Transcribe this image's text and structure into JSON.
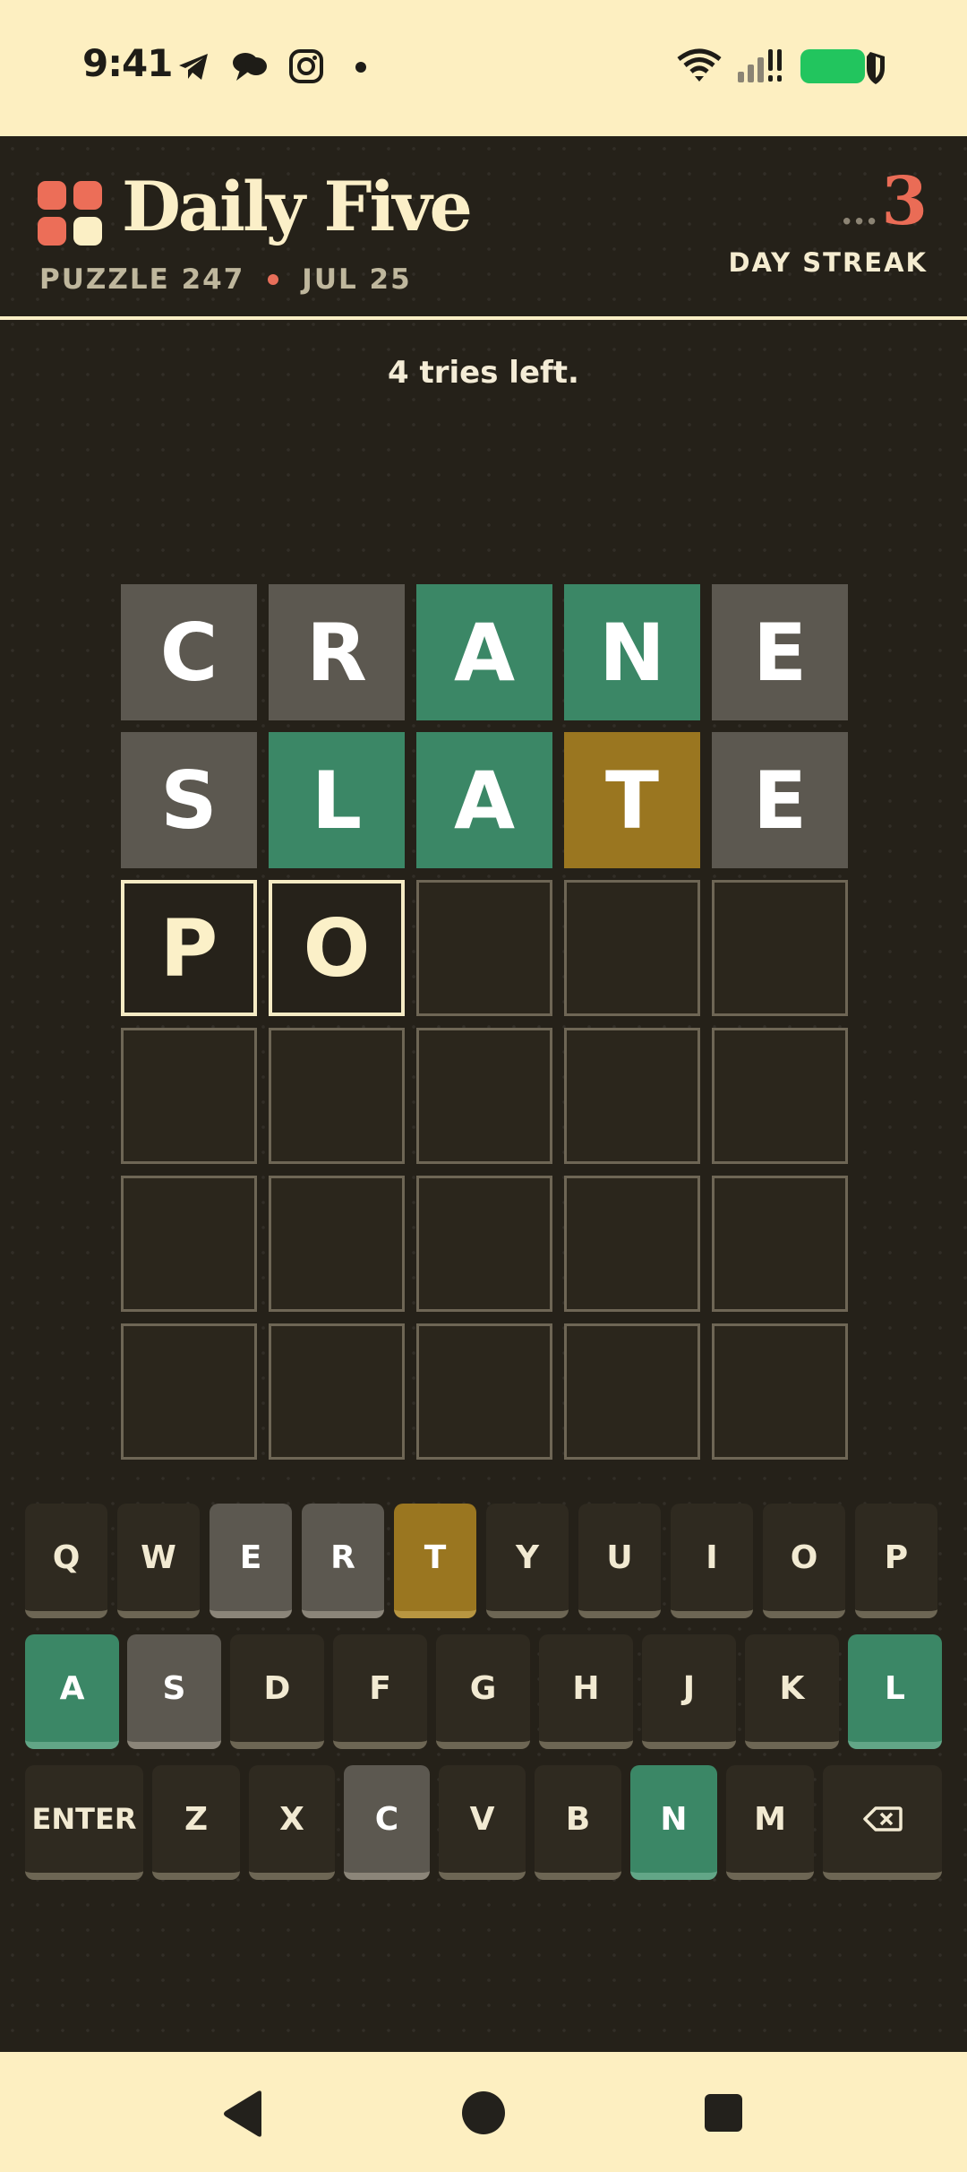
{
  "status_bar": {
    "time": "9:41",
    "left_icons": [
      "telegram-icon",
      "chat-bubble-icon",
      "instagram-icon",
      "dot-icon"
    ],
    "right_icons": [
      "wifi-icon",
      "signal-icon",
      "battery-icon",
      "shield-icon"
    ],
    "battery_color": "#22c55e"
  },
  "header": {
    "title": "Daily Five",
    "puzzle": "PUZZLE 247",
    "date": "JUL 25",
    "streak_prefix": "...",
    "streak_count": "3",
    "streak_label": "DAY STREAK",
    "logo_colors": [
      "#ec6e58",
      "#ec6e58",
      "#ec6e58",
      "#fbefc5"
    ]
  },
  "message": "4 tries left.",
  "board": {
    "rows": [
      [
        {
          "letter": "C",
          "state": "gray"
        },
        {
          "letter": "R",
          "state": "gray"
        },
        {
          "letter": "A",
          "state": "green"
        },
        {
          "letter": "N",
          "state": "green"
        },
        {
          "letter": "E",
          "state": "gray"
        }
      ],
      [
        {
          "letter": "S",
          "state": "gray"
        },
        {
          "letter": "L",
          "state": "green"
        },
        {
          "letter": "A",
          "state": "green"
        },
        {
          "letter": "T",
          "state": "gold"
        },
        {
          "letter": "E",
          "state": "gray"
        }
      ],
      [
        {
          "letter": "P",
          "state": "typed"
        },
        {
          "letter": "O",
          "state": "typed"
        },
        {
          "letter": "",
          "state": "empty"
        },
        {
          "letter": "",
          "state": "empty"
        },
        {
          "letter": "",
          "state": "empty"
        }
      ],
      [
        {
          "letter": "",
          "state": "empty"
        },
        {
          "letter": "",
          "state": "empty"
        },
        {
          "letter": "",
          "state": "empty"
        },
        {
          "letter": "",
          "state": "empty"
        },
        {
          "letter": "",
          "state": "empty"
        }
      ],
      [
        {
          "letter": "",
          "state": "empty"
        },
        {
          "letter": "",
          "state": "empty"
        },
        {
          "letter": "",
          "state": "empty"
        },
        {
          "letter": "",
          "state": "empty"
        },
        {
          "letter": "",
          "state": "empty"
        }
      ],
      [
        {
          "letter": "",
          "state": "empty"
        },
        {
          "letter": "",
          "state": "empty"
        },
        {
          "letter": "",
          "state": "empty"
        },
        {
          "letter": "",
          "state": "empty"
        },
        {
          "letter": "",
          "state": "empty"
        }
      ]
    ]
  },
  "keyboard": {
    "rows": [
      [
        {
          "label": "Q",
          "state": "none"
        },
        {
          "label": "W",
          "state": "none"
        },
        {
          "label": "E",
          "state": "gray"
        },
        {
          "label": "R",
          "state": "gray"
        },
        {
          "label": "T",
          "state": "gold"
        },
        {
          "label": "Y",
          "state": "none"
        },
        {
          "label": "U",
          "state": "none"
        },
        {
          "label": "I",
          "state": "none"
        },
        {
          "label": "O",
          "state": "none"
        },
        {
          "label": "P",
          "state": "none"
        }
      ],
      [
        {
          "label": "A",
          "state": "green"
        },
        {
          "label": "S",
          "state": "gray"
        },
        {
          "label": "D",
          "state": "none"
        },
        {
          "label": "F",
          "state": "none"
        },
        {
          "label": "G",
          "state": "none"
        },
        {
          "label": "H",
          "state": "none"
        },
        {
          "label": "J",
          "state": "none"
        },
        {
          "label": "K",
          "state": "none"
        },
        {
          "label": "L",
          "state": "green"
        }
      ],
      [
        {
          "label": "ENTER",
          "state": "none"
        },
        {
          "label": "Z",
          "state": "none"
        },
        {
          "label": "X",
          "state": "none"
        },
        {
          "label": "C",
          "state": "gray"
        },
        {
          "label": "V",
          "state": "none"
        },
        {
          "label": "B",
          "state": "none"
        },
        {
          "label": "N",
          "state": "green"
        },
        {
          "label": "M",
          "state": "none"
        },
        {
          "label": "backspace-icon",
          "state": "none"
        }
      ]
    ]
  },
  "nav_bar": {
    "icons": [
      "back-icon",
      "home-icon",
      "recents-icon"
    ]
  },
  "colors": {
    "correct": "#3b8766",
    "present": "#9a7620",
    "absent": "#5c5850",
    "background": "#252119",
    "accent": "#ea6c56"
  }
}
